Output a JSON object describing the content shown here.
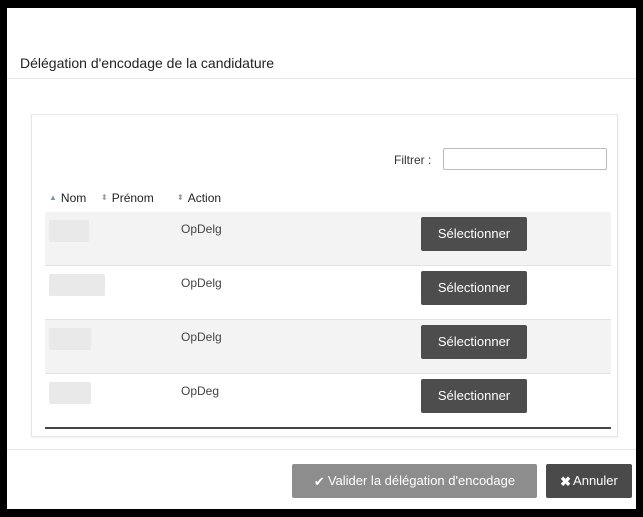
{
  "dialog": {
    "title": "Délégation d'encodage de la candidature"
  },
  "filter": {
    "label": "Filtrer :",
    "value": ""
  },
  "table": {
    "columns": [
      {
        "label": "Nom",
        "sort": "ascending"
      },
      {
        "label": "Prénom",
        "sort": "none"
      },
      {
        "label": "Action",
        "sort": "none"
      }
    ],
    "rows": [
      {
        "nom": "",
        "prenom": "",
        "action": "OpDelg",
        "button": "Sélectionner"
      },
      {
        "nom": "",
        "prenom": "",
        "action": "OpDelg",
        "button": "Sélectionner"
      },
      {
        "nom": "",
        "prenom": "",
        "action": "OpDelg",
        "button": "Sélectionner"
      },
      {
        "nom": "",
        "prenom": "",
        "action": "OpDeg",
        "button": "Sélectionner"
      }
    ]
  },
  "footer": {
    "validate_label": "Valider la délégation d'encodage",
    "cancel_label": "Annuler"
  },
  "icons": {
    "sort_asc": "sort-up-icon",
    "sort_both": "sort-icon",
    "validate": "check-icon",
    "cancel": "close-icon"
  },
  "colors": {
    "button_dark": "#4d4d4d",
    "button_disabled": "#8d8d8d",
    "sort_active": "#7a93b8"
  }
}
